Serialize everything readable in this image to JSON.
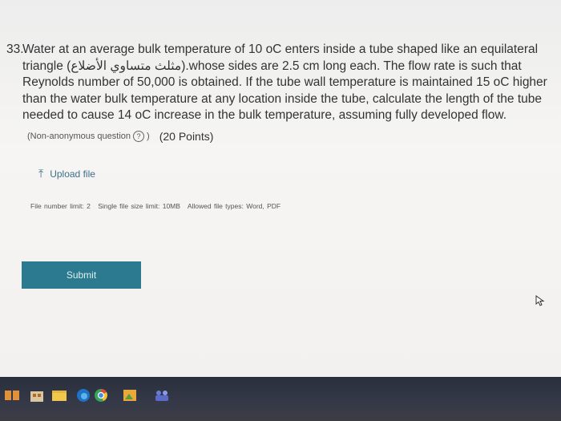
{
  "question": {
    "number": "33.",
    "text": "Water at an average bulk temperature of 10 oC enters inside a tube shaped like an equilateral triangle (مثلث متساوي الأضلاع).whose sides are 2.5 cm long each. The flow rate is such that Reynolds number of 50,000 is obtained. If the tube wall temperature is maintained 15 oC higher than the water bulk temperature at any location inside the tube, calculate the length of the tube needed to cause 14 oC increase in the bulk temperature, assuming fully developed flow.",
    "anon_label": "(Non-anonymous question",
    "help_glyph": "?",
    "paren_close": ")",
    "points": "(20 Points)"
  },
  "upload": {
    "icon": "upload-arrow-icon",
    "label": "Upload file"
  },
  "limits": {
    "file_number": "File number limit: 2",
    "file_size": "Single file size limit: 10MB",
    "file_types": "Allowed file types: Word, PDF"
  },
  "submit": {
    "label": "Submit"
  },
  "colors": {
    "submit_bg": "#2b7a8f",
    "link": "#3b6f8a",
    "taskbar": "#2e3240"
  },
  "taskbar": {
    "icons": [
      "task-view-icon",
      "store-icon",
      "folder-icon",
      "edge-icon",
      "chrome-icon",
      "photos-icon",
      "teams-icon"
    ]
  }
}
